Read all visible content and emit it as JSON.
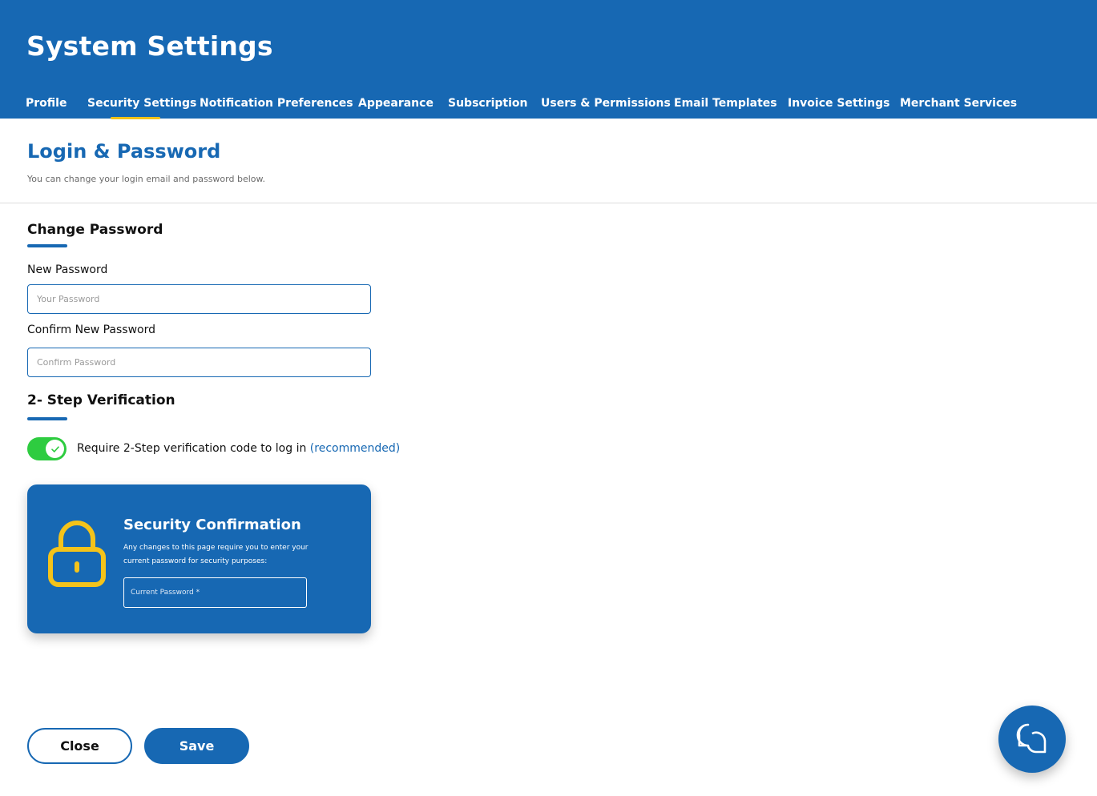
{
  "header": {
    "title": "System Settings",
    "tabs": [
      {
        "label": "Profile"
      },
      {
        "label": "Security Settings"
      },
      {
        "label": "Notification Preferences"
      },
      {
        "label": "Appearance"
      },
      {
        "label": "Subscription"
      },
      {
        "label": "Users & Permissions"
      },
      {
        "label": "Email Templates"
      },
      {
        "label": "Invoice Settings"
      },
      {
        "label": "Merchant Services"
      }
    ],
    "active_tab": "Security Settings"
  },
  "section": {
    "title": "Login & Password",
    "subtitle": "You can change your login email and password below."
  },
  "change_password": {
    "heading": "Change Password",
    "new_password_label": "New Password",
    "new_password_placeholder": "Your Password",
    "new_password_value": "",
    "confirm_label": "Confirm New Password",
    "confirm_placeholder": "Confirm Password",
    "confirm_value": ""
  },
  "two_step": {
    "heading": "2- Step Verification",
    "toggle_on": true,
    "label": "Require 2-Step verification code to log in ",
    "recommended": "(recommended)"
  },
  "security_confirmation": {
    "title": "Security Confirmation",
    "text": "Any changes to this page require you to enter your current password for security purposes:",
    "placeholder": "Current Password *",
    "icon": "lock-icon"
  },
  "actions": {
    "close_label": "Close",
    "save_label": "Save"
  },
  "chat": {
    "icon": "chat-icon"
  },
  "colors": {
    "brand_blue": "#1768b3",
    "tab_underline": "#f4c31a",
    "toggle_on": "#2ecc40",
    "lock_yellow": "#f4c31a"
  }
}
